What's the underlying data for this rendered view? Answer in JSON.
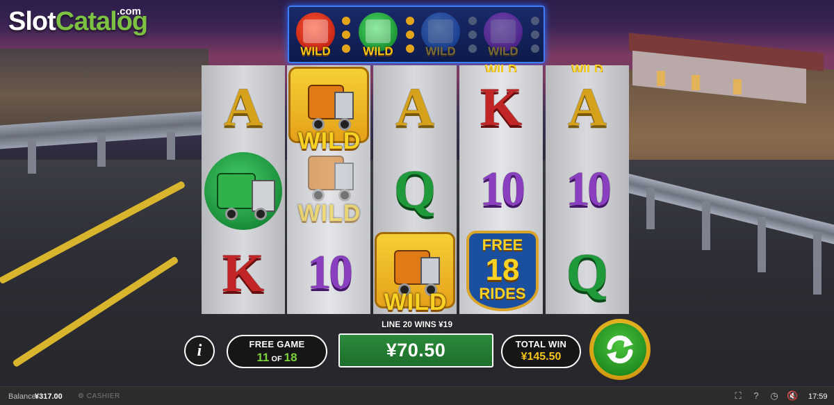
{
  "logo": {
    "brand_part1": "Slot",
    "brand_part2": "Catalog",
    "suffix": ".com"
  },
  "wild_meter": {
    "items": [
      {
        "color": "red",
        "label": "WILD",
        "collected": true
      },
      {
        "color": "green",
        "label": "WILD",
        "collected": true
      },
      {
        "color": "blue",
        "label": "WILD",
        "collected": false
      },
      {
        "color": "purple",
        "label": "WILD",
        "collected": false
      }
    ]
  },
  "reels": {
    "reel1": [
      "A",
      "green-truck",
      "K"
    ],
    "reel2": [
      "WILD",
      "WILD",
      "10"
    ],
    "reel3": [
      "A",
      "Q",
      "WILD"
    ],
    "reel4": [
      "K",
      "10",
      "FREE 18 RIDES"
    ],
    "reel5": [
      "A",
      "10",
      "Q"
    ],
    "peek_top": [
      "WILD",
      "WILD"
    ]
  },
  "symbols": {
    "r1c1": "A",
    "r1c3": "K",
    "r2c1_wild": "WILD",
    "r2c2_wild": "WILD",
    "r2c3": "10",
    "r3c1": "A",
    "r3c2": "Q",
    "r3c3_wild": "WILD",
    "r4c1": "K",
    "r4c2": "10",
    "r5c1": "A",
    "r5c2": "10",
    "r5c3": "Q",
    "peek_wild_4": "WILD",
    "peek_wild_5": "WILD"
  },
  "free_badge": {
    "top": "FREE",
    "number": "18",
    "bottom": "RIDES"
  },
  "line_win": "LINE 20 WINS ¥19",
  "controls": {
    "info_label": "i",
    "free_game_title": "FREE GAME",
    "free_game_current": "11",
    "free_game_of": "OF",
    "free_game_total": "18",
    "win_amount": "¥70.50",
    "total_win_title": "TOTAL WIN",
    "total_win_value": "¥145.50"
  },
  "statusbar": {
    "balance_label": "Balance",
    "balance_value": "¥317.00",
    "cashier_label": "CASHIER",
    "time": "17:59"
  },
  "colors": {
    "accent_green": "#7dd23a",
    "accent_gold": "#f6c417",
    "meter_border": "#3f7dff",
    "win_box": "#1d6e2b"
  }
}
